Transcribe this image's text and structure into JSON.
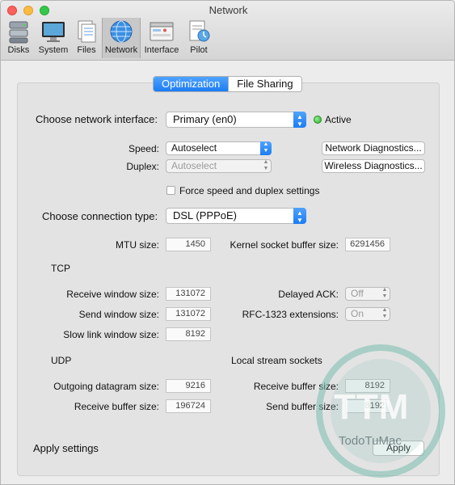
{
  "window": {
    "title": "Network"
  },
  "toolbar": {
    "items": [
      {
        "label": "Disks",
        "icon": "disks-icon"
      },
      {
        "label": "System",
        "icon": "system-icon"
      },
      {
        "label": "Files",
        "icon": "files-icon"
      },
      {
        "label": "Network",
        "icon": "network-icon",
        "selected": true
      },
      {
        "label": "Interface",
        "icon": "interface-icon"
      },
      {
        "label": "Pilot",
        "icon": "pilot-icon"
      }
    ]
  },
  "tabs": [
    {
      "label": "Optimization",
      "selected": true
    },
    {
      "label": "File Sharing",
      "selected": false
    }
  ],
  "interface": {
    "label": "Choose network interface:",
    "value": "Primary (en0)",
    "status": "Active"
  },
  "speed": {
    "label": "Speed:",
    "value": "Autoselect"
  },
  "duplex": {
    "label": "Duplex:",
    "value": "Autoselect"
  },
  "buttons": {
    "network_diag": "Network Diagnostics...",
    "wireless_diag": "Wireless Diagnostics...",
    "apply": "Apply"
  },
  "force_checkbox": {
    "label": "Force speed and duplex settings",
    "checked": false
  },
  "connection": {
    "label": "Choose connection type:",
    "value": "DSL (PPPoE)"
  },
  "mtu": {
    "label": "MTU size:",
    "value": "1450"
  },
  "kernel_buffer": {
    "label": "Kernel socket buffer size:",
    "value": "6291456"
  },
  "tcp": {
    "heading": "TCP",
    "receive_window": {
      "label": "Receive window size:",
      "value": "131072"
    },
    "send_window": {
      "label": "Send window size:",
      "value": "131072"
    },
    "slow_link": {
      "label": "Slow link window size:",
      "value": "8192"
    },
    "delayed_ack": {
      "label": "Delayed ACK:",
      "value": "Off"
    },
    "rfc1323": {
      "label": "RFC-1323 extensions:",
      "value": "On"
    }
  },
  "udp": {
    "heading": "UDP",
    "outgoing": {
      "label": "Outgoing datagram size:",
      "value": "9216"
    },
    "receive_buffer": {
      "label": "Receive buffer size:",
      "value": "196724"
    }
  },
  "local": {
    "heading": "Local stream sockets",
    "receive_buffer": {
      "label": "Receive buffer size:",
      "value": "8192"
    },
    "send_buffer": {
      "label": "Send buffer size:",
      "value": "8192"
    }
  },
  "apply_settings": {
    "label": "Apply settings"
  },
  "watermark": {
    "text": "TTM",
    "caption": "TodoTuMac"
  },
  "colors": {
    "accent": "#1c7cf4",
    "active_dot": "#2da92d"
  }
}
